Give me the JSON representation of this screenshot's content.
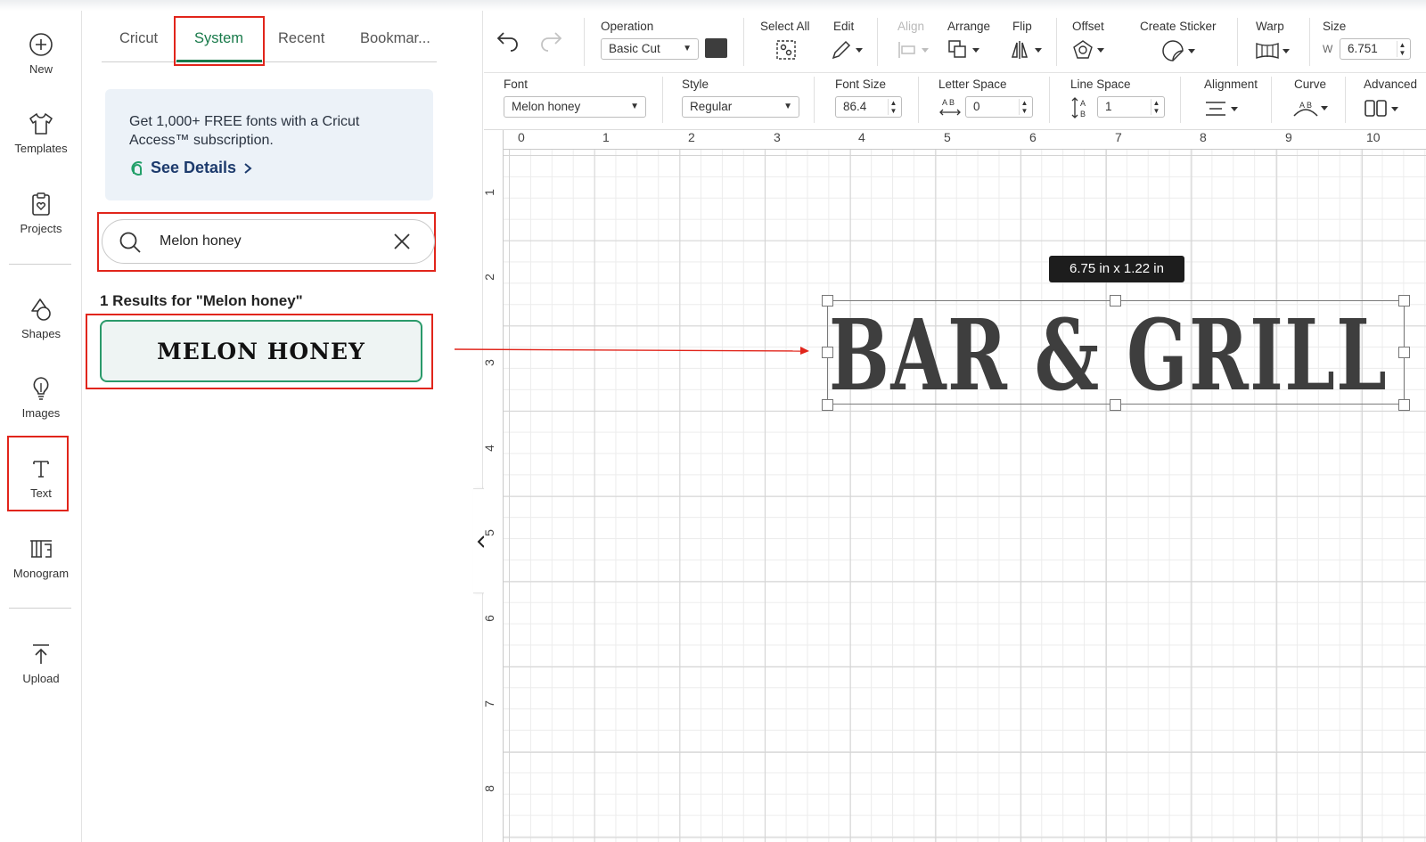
{
  "rail": {
    "items": [
      {
        "label": "New",
        "icon": "plus-circle-icon"
      },
      {
        "label": "Templates",
        "icon": "shirt-icon"
      },
      {
        "label": "Projects",
        "icon": "clipboard-heart-icon"
      },
      {
        "label": "Shapes",
        "icon": "shapes-icon"
      },
      {
        "label": "Images",
        "icon": "lightbulb-icon"
      },
      {
        "label": "Text",
        "icon": "text-t-icon"
      },
      {
        "label": "Monogram",
        "icon": "monogram-icon"
      },
      {
        "label": "Upload",
        "icon": "upload-arrow-icon"
      }
    ]
  },
  "panel": {
    "tabs": [
      "Cricut",
      "System",
      "Recent",
      "Bookmar..."
    ],
    "active_tab": "System",
    "promo": {
      "text": "Get 1,000+ FREE fonts with a Cricut Access™ subscription.",
      "link": "See Details"
    },
    "search": {
      "value": "Melon honey"
    },
    "results_label": "1 Results for \"Melon honey\"",
    "results": [
      {
        "name": "Melon honey",
        "preview": "MELON HONEY"
      }
    ]
  },
  "toolbar": {
    "operation": {
      "label": "Operation",
      "value": "Basic Cut",
      "color": "#3d3d3d"
    },
    "select_all": "Select All",
    "edit": "Edit",
    "align": "Align",
    "arrange": "Arrange",
    "flip": "Flip",
    "offset": "Offset",
    "create_sticker": "Create Sticker",
    "warp": "Warp",
    "size": {
      "label": "Size",
      "w_label": "W",
      "w_value": "6.751"
    }
  },
  "text_toolbar": {
    "font": {
      "label": "Font",
      "value": "Melon honey"
    },
    "style": {
      "label": "Style",
      "value": "Regular"
    },
    "font_size": {
      "label": "Font Size",
      "value": "86.4"
    },
    "letter_space": {
      "label": "Letter Space",
      "value": "0"
    },
    "line_space": {
      "label": "Line Space",
      "value": "1"
    },
    "alignment": "Alignment",
    "curve": "Curve",
    "advanced": "Advanced"
  },
  "canvas": {
    "ruler_x": [
      "0",
      "1",
      "2",
      "3",
      "4",
      "5",
      "6",
      "7",
      "8",
      "9",
      "10"
    ],
    "ruler_y": [
      "1",
      "2",
      "3",
      "4",
      "5",
      "6",
      "7",
      "8"
    ],
    "tooltip": "6.75  in x 1.22  in",
    "text": "BAR & GRILL"
  },
  "colors": {
    "accent": "#187a4a",
    "highlight": "#e1251b",
    "card_border": "#2a9a6a"
  }
}
